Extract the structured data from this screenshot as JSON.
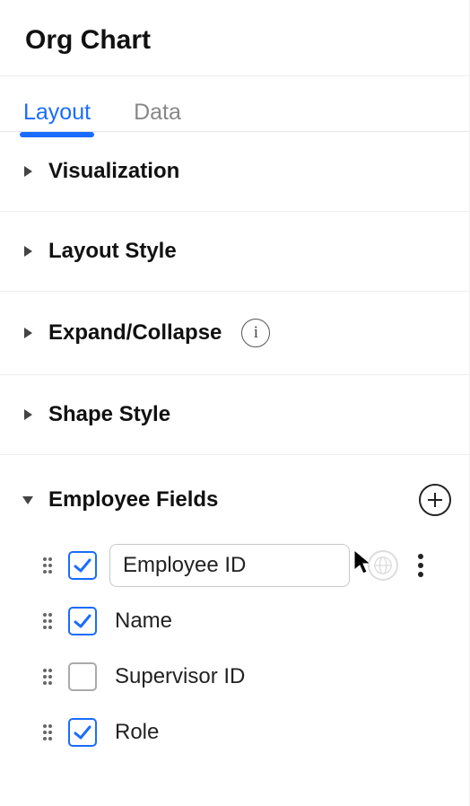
{
  "panel": {
    "title": "Org Chart"
  },
  "tabs": {
    "layout": "Layout",
    "data": "Data",
    "active": "layout"
  },
  "sections": {
    "visualization": "Visualization",
    "layoutStyle": "Layout Style",
    "expandCollapse": "Expand/Collapse",
    "shapeStyle": "Shape Style",
    "employeeFields": "Employee Fields"
  },
  "fields": [
    {
      "label": "Employee ID",
      "checked": true,
      "editing": true
    },
    {
      "label": "Name",
      "checked": true,
      "editing": false
    },
    {
      "label": "Supervisor ID",
      "checked": false,
      "editing": false
    },
    {
      "label": "Role",
      "checked": true,
      "editing": false
    }
  ]
}
